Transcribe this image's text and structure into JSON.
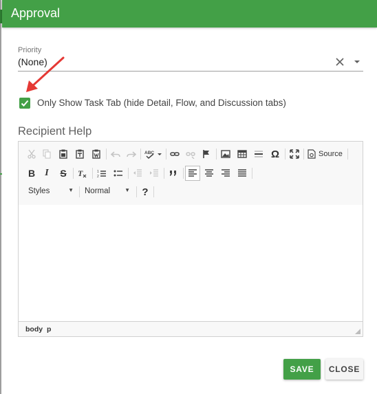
{
  "dialog": {
    "title": "Approval",
    "accent_color": "#43a047"
  },
  "priority": {
    "label": "Priority",
    "value": "(None)"
  },
  "task_tab_option": {
    "checked": true,
    "label": "Only Show Task Tab (hide Detail, Flow, and Discussion tabs)"
  },
  "recipient_help": {
    "title": "Recipient Help",
    "toolbar": {
      "source_label": "Source",
      "styles_label": "Styles",
      "format_label": "Normal",
      "help_label": "?",
      "bold_label": "B",
      "italic_label": "I",
      "strike_label": "S",
      "omega_label": "Ω"
    },
    "status_path": [
      "body",
      "p"
    ]
  },
  "actions": {
    "save_label": "SAVE",
    "close_label": "CLOSE"
  }
}
